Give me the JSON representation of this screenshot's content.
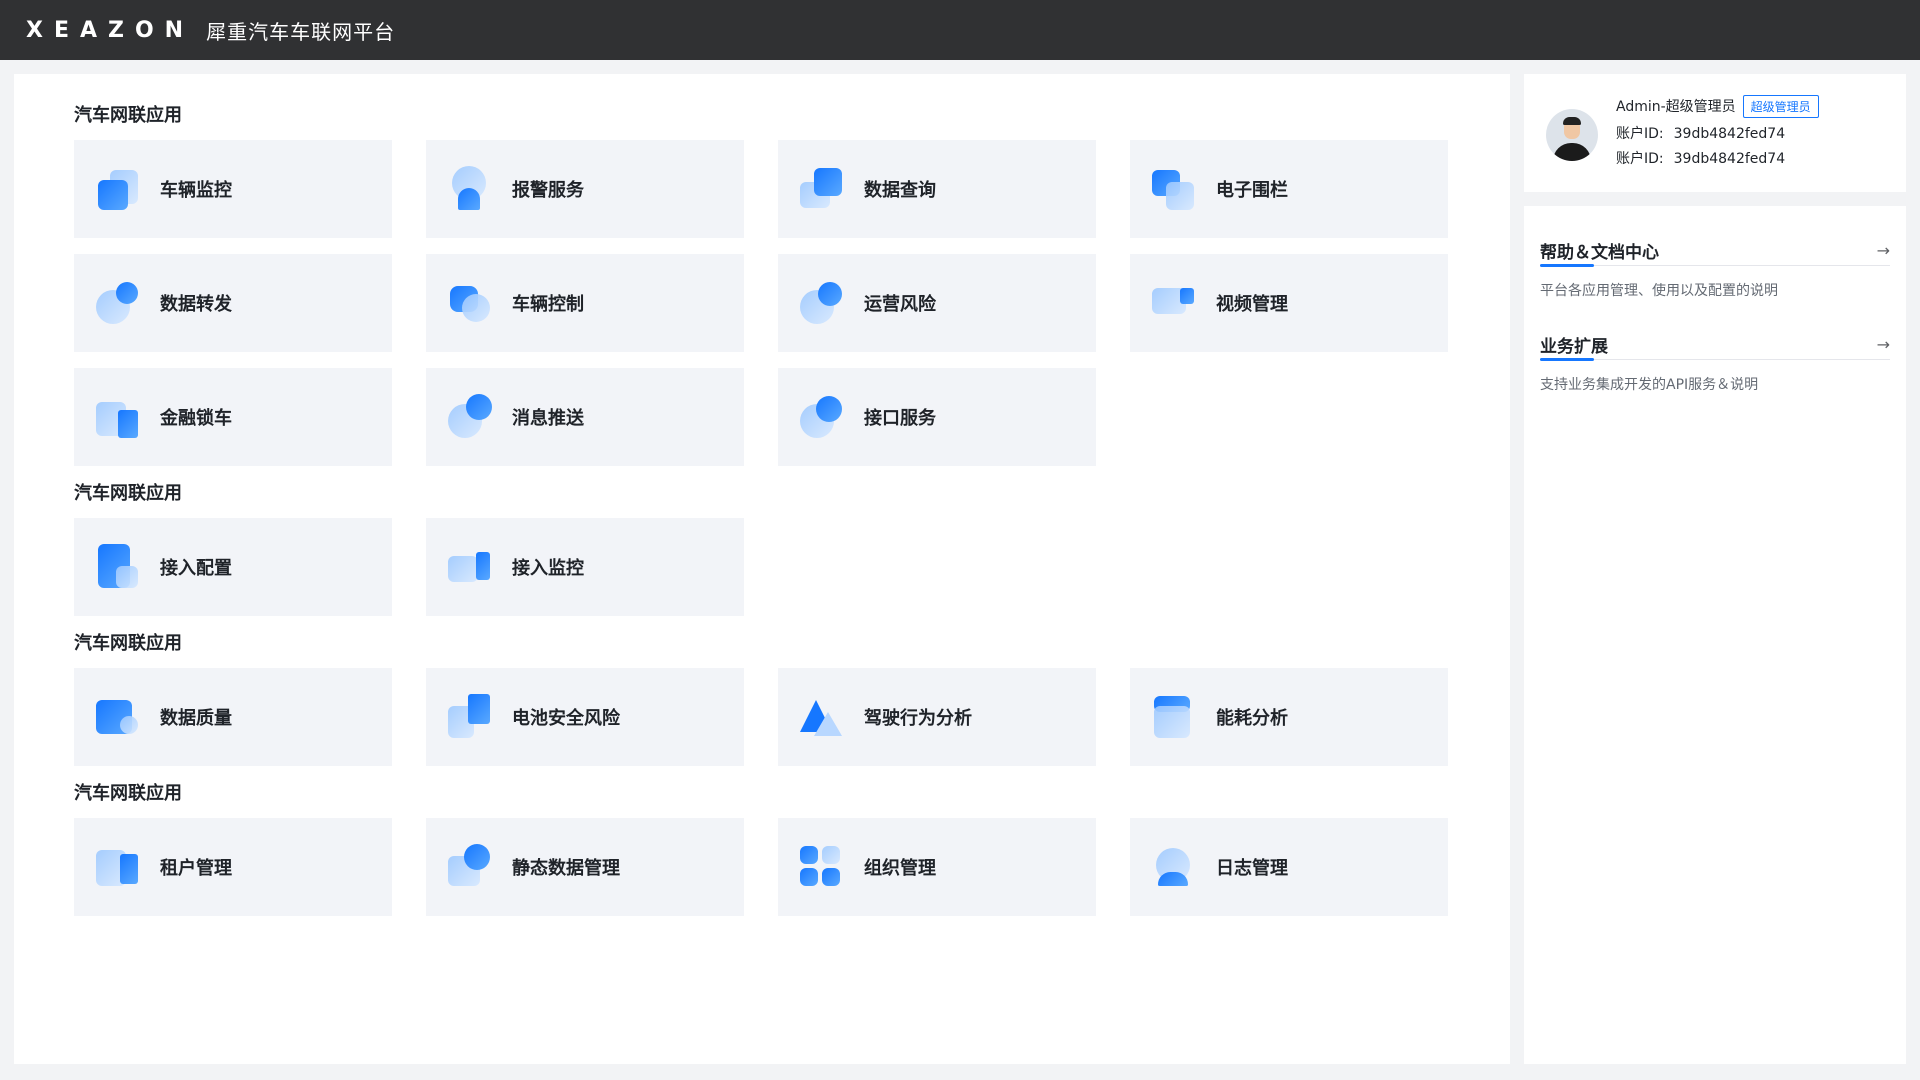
{
  "header": {
    "logo": "XEAZON",
    "platform": "犀重汽车车联网平台"
  },
  "sections": [
    {
      "title": "汽车网联应用",
      "items": [
        {
          "label": "车辆监控",
          "icon": "vehicle-monitor-icon"
        },
        {
          "label": "报警服务",
          "icon": "alarm-service-icon"
        },
        {
          "label": "数据查询",
          "icon": "data-query-icon"
        },
        {
          "label": "电子围栏",
          "icon": "geofence-icon"
        },
        {
          "label": "数据转发",
          "icon": "data-forward-icon"
        },
        {
          "label": "车辆控制",
          "icon": "vehicle-control-icon"
        },
        {
          "label": "运营风险",
          "icon": "operation-risk-icon"
        },
        {
          "label": "视频管理",
          "icon": "video-manage-icon"
        },
        {
          "label": "金融锁车",
          "icon": "finance-lock-icon"
        },
        {
          "label": "消息推送",
          "icon": "message-push-icon"
        },
        {
          "label": "接口服务",
          "icon": "api-service-icon"
        }
      ]
    },
    {
      "title": "汽车网联应用",
      "items": [
        {
          "label": "接入配置",
          "icon": "access-config-icon"
        },
        {
          "label": "接入监控",
          "icon": "access-monitor-icon"
        }
      ]
    },
    {
      "title": "汽车网联应用",
      "items": [
        {
          "label": "数据质量",
          "icon": "data-quality-icon"
        },
        {
          "label": "电池安全风险",
          "icon": "battery-risk-icon"
        },
        {
          "label": "驾驶行为分析",
          "icon": "driving-analysis-icon"
        },
        {
          "label": "能耗分析",
          "icon": "energy-analysis-icon"
        }
      ]
    },
    {
      "title": "汽车网联应用",
      "items": [
        {
          "label": "租户管理",
          "icon": "tenant-manage-icon"
        },
        {
          "label": "静态数据管理",
          "icon": "static-data-icon"
        },
        {
          "label": "组织管理",
          "icon": "organization-icon"
        },
        {
          "label": "日志管理",
          "icon": "log-manage-icon"
        }
      ]
    }
  ],
  "profile": {
    "name": "Admin-超级管理员",
    "badge": "超级管理员",
    "account_label": "账户ID:",
    "account_id": "39db4842fed74",
    "account_label2": "账户ID:",
    "account_id2": "39db4842fed74"
  },
  "docs": [
    {
      "title": "帮助＆文档中心",
      "desc": "平台各应用管理、使用以及配置的说明"
    },
    {
      "title": "业务扩展",
      "desc": "支持业务集成开发的API服务＆说明"
    }
  ],
  "colors": {
    "topbar": "#303133",
    "accent": "#1677ff",
    "card": "#f2f4f8"
  }
}
